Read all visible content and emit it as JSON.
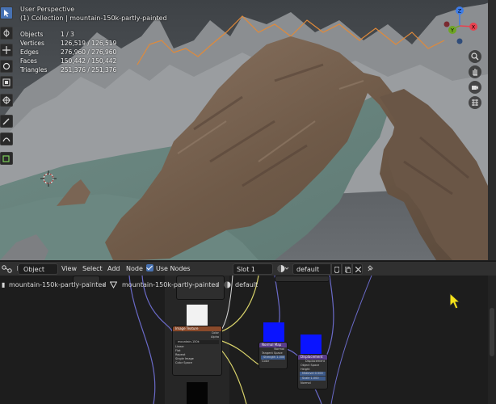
{
  "viewport": {
    "title": "User Perspective",
    "collection": "(1) Collection | mountain-150k-partly-painted",
    "stats": [
      {
        "label": "Objects",
        "value": "1 / 3"
      },
      {
        "label": "Vertices",
        "value": "126,519 / 126,519"
      },
      {
        "label": "Edges",
        "value": "276,960 / 276,960"
      },
      {
        "label": "Faces",
        "value": "150,442 / 150,442"
      },
      {
        "label": "Triangles",
        "value": "251,376 / 251,376"
      }
    ],
    "gizmo": {
      "x_label": "X",
      "y_label": "Y",
      "z_label": "Z",
      "x_color": "#e8424f",
      "y_color": "#6ea524",
      "z_color": "#3d7ce8"
    }
  },
  "editor_header": {
    "mode": "Object",
    "menus": [
      "View",
      "Select",
      "Add",
      "Node"
    ],
    "use_nodes_label": "Use Nodes",
    "slot": "Slot 1",
    "material": "default"
  },
  "breadcrumb": {
    "object": "mountain-150k-partly-painted",
    "mesh": "mountain-150k-partly-painted",
    "material": "default"
  },
  "nodes": {
    "image_texture": {
      "title": "Image Texture",
      "image": "mountain-150k",
      "rows": [
        "Color",
        "Alpha",
        "Linear",
        "Flat",
        "Repeat",
        "Single Image",
        "Color Space",
        "Non-Color",
        "Alpha",
        "Vector"
      ]
    },
    "normal_map": {
      "title": "Normal Map",
      "rows": [
        "Normal",
        "Tangent Space",
        "Strength 1.000",
        "Color"
      ]
    },
    "displacement": {
      "title": "Displacement",
      "rows": [
        "Displacement",
        "Object Space",
        "Height",
        "Midlevel 0.500",
        "Scale 1.000",
        "Normal"
      ]
    }
  },
  "colors": {
    "accent": "#4772b3",
    "node_blue": "#0a14ff",
    "image_header": "#8a4a2b"
  }
}
